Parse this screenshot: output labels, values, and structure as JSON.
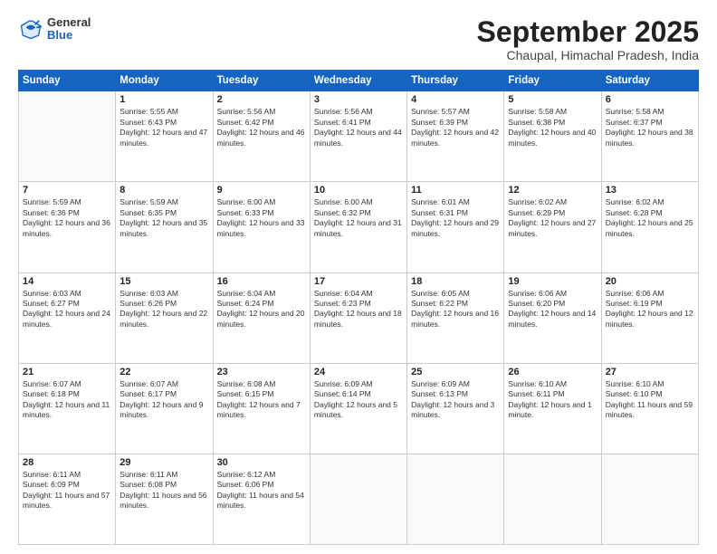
{
  "header": {
    "logo_general": "General",
    "logo_blue": "Blue",
    "month_title": "September 2025",
    "location": "Chaupal, Himachal Pradesh, India"
  },
  "weekdays": [
    "Sunday",
    "Monday",
    "Tuesday",
    "Wednesday",
    "Thursday",
    "Friday",
    "Saturday"
  ],
  "weeks": [
    [
      {
        "day": "",
        "sunrise": "",
        "sunset": "",
        "daylight": ""
      },
      {
        "day": "1",
        "sunrise": "Sunrise: 5:55 AM",
        "sunset": "Sunset: 6:43 PM",
        "daylight": "Daylight: 12 hours and 47 minutes."
      },
      {
        "day": "2",
        "sunrise": "Sunrise: 5:56 AM",
        "sunset": "Sunset: 6:42 PM",
        "daylight": "Daylight: 12 hours and 46 minutes."
      },
      {
        "day": "3",
        "sunrise": "Sunrise: 5:56 AM",
        "sunset": "Sunset: 6:41 PM",
        "daylight": "Daylight: 12 hours and 44 minutes."
      },
      {
        "day": "4",
        "sunrise": "Sunrise: 5:57 AM",
        "sunset": "Sunset: 6:39 PM",
        "daylight": "Daylight: 12 hours and 42 minutes."
      },
      {
        "day": "5",
        "sunrise": "Sunrise: 5:58 AM",
        "sunset": "Sunset: 6:38 PM",
        "daylight": "Daylight: 12 hours and 40 minutes."
      },
      {
        "day": "6",
        "sunrise": "Sunrise: 5:58 AM",
        "sunset": "Sunset: 6:37 PM",
        "daylight": "Daylight: 12 hours and 38 minutes."
      }
    ],
    [
      {
        "day": "7",
        "sunrise": "Sunrise: 5:59 AM",
        "sunset": "Sunset: 6:36 PM",
        "daylight": "Daylight: 12 hours and 36 minutes."
      },
      {
        "day": "8",
        "sunrise": "Sunrise: 5:59 AM",
        "sunset": "Sunset: 6:35 PM",
        "daylight": "Daylight: 12 hours and 35 minutes."
      },
      {
        "day": "9",
        "sunrise": "Sunrise: 6:00 AM",
        "sunset": "Sunset: 6:33 PM",
        "daylight": "Daylight: 12 hours and 33 minutes."
      },
      {
        "day": "10",
        "sunrise": "Sunrise: 6:00 AM",
        "sunset": "Sunset: 6:32 PM",
        "daylight": "Daylight: 12 hours and 31 minutes."
      },
      {
        "day": "11",
        "sunrise": "Sunrise: 6:01 AM",
        "sunset": "Sunset: 6:31 PM",
        "daylight": "Daylight: 12 hours and 29 minutes."
      },
      {
        "day": "12",
        "sunrise": "Sunrise: 6:02 AM",
        "sunset": "Sunset: 6:29 PM",
        "daylight": "Daylight: 12 hours and 27 minutes."
      },
      {
        "day": "13",
        "sunrise": "Sunrise: 6:02 AM",
        "sunset": "Sunset: 6:28 PM",
        "daylight": "Daylight: 12 hours and 25 minutes."
      }
    ],
    [
      {
        "day": "14",
        "sunrise": "Sunrise: 6:03 AM",
        "sunset": "Sunset: 6:27 PM",
        "daylight": "Daylight: 12 hours and 24 minutes."
      },
      {
        "day": "15",
        "sunrise": "Sunrise: 6:03 AM",
        "sunset": "Sunset: 6:26 PM",
        "daylight": "Daylight: 12 hours and 22 minutes."
      },
      {
        "day": "16",
        "sunrise": "Sunrise: 6:04 AM",
        "sunset": "Sunset: 6:24 PM",
        "daylight": "Daylight: 12 hours and 20 minutes."
      },
      {
        "day": "17",
        "sunrise": "Sunrise: 6:04 AM",
        "sunset": "Sunset: 6:23 PM",
        "daylight": "Daylight: 12 hours and 18 minutes."
      },
      {
        "day": "18",
        "sunrise": "Sunrise: 6:05 AM",
        "sunset": "Sunset: 6:22 PM",
        "daylight": "Daylight: 12 hours and 16 minutes."
      },
      {
        "day": "19",
        "sunrise": "Sunrise: 6:06 AM",
        "sunset": "Sunset: 6:20 PM",
        "daylight": "Daylight: 12 hours and 14 minutes."
      },
      {
        "day": "20",
        "sunrise": "Sunrise: 6:06 AM",
        "sunset": "Sunset: 6:19 PM",
        "daylight": "Daylight: 12 hours and 12 minutes."
      }
    ],
    [
      {
        "day": "21",
        "sunrise": "Sunrise: 6:07 AM",
        "sunset": "Sunset: 6:18 PM",
        "daylight": "Daylight: 12 hours and 11 minutes."
      },
      {
        "day": "22",
        "sunrise": "Sunrise: 6:07 AM",
        "sunset": "Sunset: 6:17 PM",
        "daylight": "Daylight: 12 hours and 9 minutes."
      },
      {
        "day": "23",
        "sunrise": "Sunrise: 6:08 AM",
        "sunset": "Sunset: 6:15 PM",
        "daylight": "Daylight: 12 hours and 7 minutes."
      },
      {
        "day": "24",
        "sunrise": "Sunrise: 6:09 AM",
        "sunset": "Sunset: 6:14 PM",
        "daylight": "Daylight: 12 hours and 5 minutes."
      },
      {
        "day": "25",
        "sunrise": "Sunrise: 6:09 AM",
        "sunset": "Sunset: 6:13 PM",
        "daylight": "Daylight: 12 hours and 3 minutes."
      },
      {
        "day": "26",
        "sunrise": "Sunrise: 6:10 AM",
        "sunset": "Sunset: 6:11 PM",
        "daylight": "Daylight: 12 hours and 1 minute."
      },
      {
        "day": "27",
        "sunrise": "Sunrise: 6:10 AM",
        "sunset": "Sunset: 6:10 PM",
        "daylight": "Daylight: 11 hours and 59 minutes."
      }
    ],
    [
      {
        "day": "28",
        "sunrise": "Sunrise: 6:11 AM",
        "sunset": "Sunset: 6:09 PM",
        "daylight": "Daylight: 11 hours and 57 minutes."
      },
      {
        "day": "29",
        "sunrise": "Sunrise: 6:11 AM",
        "sunset": "Sunset: 6:08 PM",
        "daylight": "Daylight: 11 hours and 56 minutes."
      },
      {
        "day": "30",
        "sunrise": "Sunrise: 6:12 AM",
        "sunset": "Sunset: 6:06 PM",
        "daylight": "Daylight: 11 hours and 54 minutes."
      },
      {
        "day": "",
        "sunrise": "",
        "sunset": "",
        "daylight": ""
      },
      {
        "day": "",
        "sunrise": "",
        "sunset": "",
        "daylight": ""
      },
      {
        "day": "",
        "sunrise": "",
        "sunset": "",
        "daylight": ""
      },
      {
        "day": "",
        "sunrise": "",
        "sunset": "",
        "daylight": ""
      }
    ]
  ]
}
